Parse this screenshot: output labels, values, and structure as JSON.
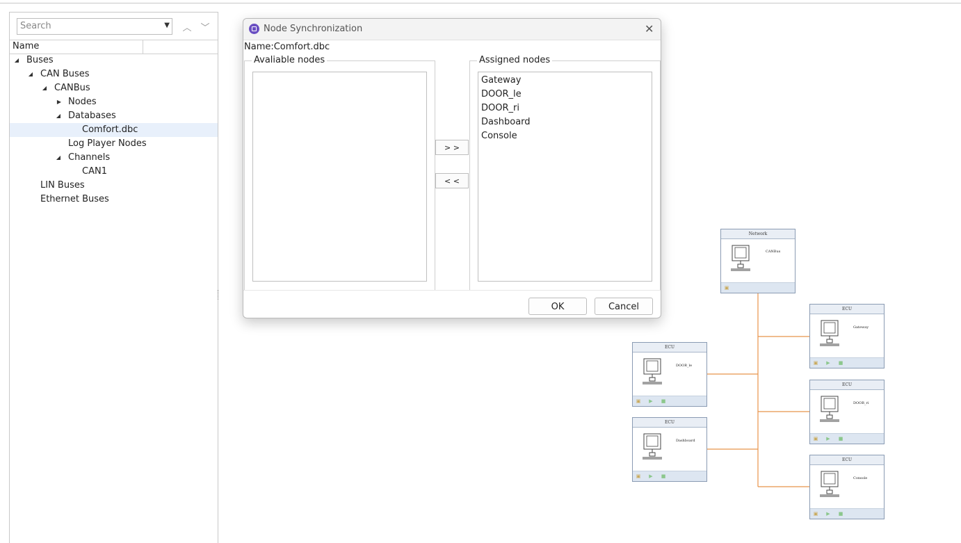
{
  "tree_panel": {
    "search": {
      "placeholder": "Search",
      "value": ""
    },
    "column_header": "Name",
    "items": [
      {
        "label": "Buses",
        "expanded": true
      },
      {
        "label": "CAN Buses",
        "expanded": true
      },
      {
        "label": "CANBus",
        "expanded": true
      },
      {
        "label": "Nodes",
        "expanded": false
      },
      {
        "label": "Databases",
        "expanded": true
      },
      {
        "label": "Comfort.dbc",
        "selected": true
      },
      {
        "label": "Log Player Nodes"
      },
      {
        "label": "Channels",
        "expanded": true
      },
      {
        "label": "CAN1"
      },
      {
        "label": "LIN Buses"
      },
      {
        "label": "Ethernet Buses"
      }
    ]
  },
  "dialog": {
    "title": "Node Synchronization",
    "name_prefix": "Name:",
    "name_value": "Comfort.dbc",
    "available_label": "Avaliable nodes",
    "assigned_label": "Assigned nodes",
    "available_nodes": [],
    "assigned_nodes": [
      "Gateway",
      "DOOR_le",
      "DOOR_ri",
      "Dashboard",
      "Console"
    ],
    "add_button": "> >",
    "remove_button": "< <",
    "ok_button": "OK",
    "cancel_button": "Cancel"
  },
  "network": {
    "bus": {
      "header": "Network",
      "name": "CANBus"
    },
    "ecus": [
      {
        "header": "ECU",
        "name": "Gateway"
      },
      {
        "header": "ECU",
        "name": "DOOR_le"
      },
      {
        "header": "ECU",
        "name": "DOOR_ri"
      },
      {
        "header": "ECU",
        "name": "Dashboard"
      },
      {
        "header": "ECU",
        "name": "Console"
      }
    ],
    "line_color": "#e8934a"
  }
}
